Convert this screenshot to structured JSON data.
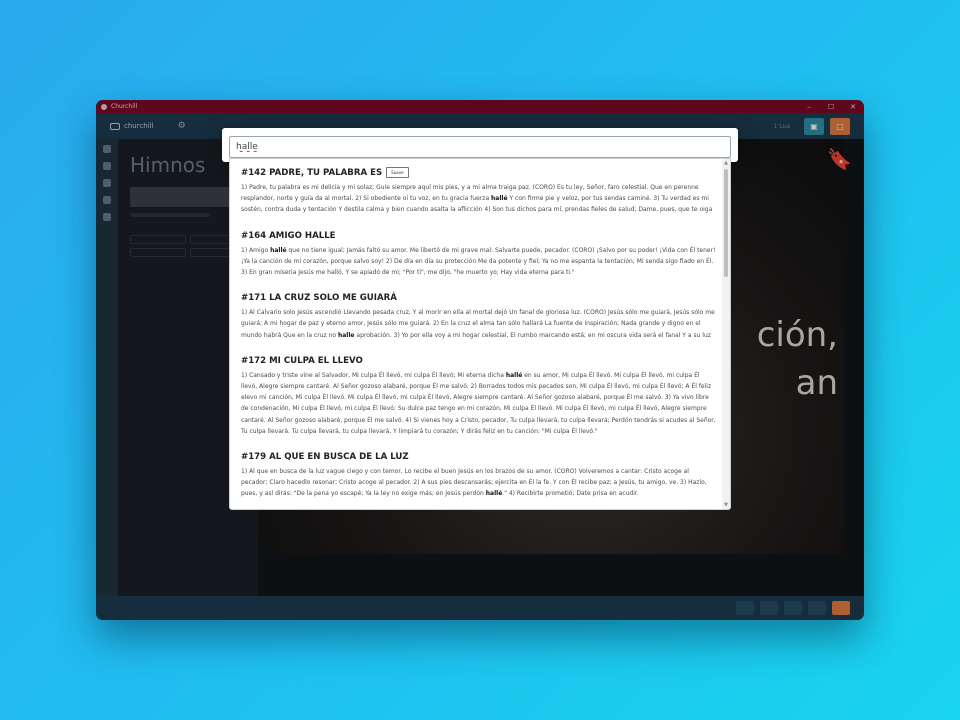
{
  "window": {
    "title": "Churchill",
    "minimize": "–",
    "maximize": "☐",
    "close": "✕"
  },
  "topbar": {
    "app_name": "churchill",
    "language": "1 Lua"
  },
  "left_panel": {
    "heading": "Himnos"
  },
  "preview": {
    "lyric_line_1": "ción,",
    "lyric_line_2": "an"
  },
  "search": {
    "value": "halle"
  },
  "results": [
    {
      "title": "#142 PADRE, TU PALABRA ES",
      "badge": "Suave",
      "text_before": "1) Padre, tu palabra es mi delicia y mi solaz; Guíe siempre aquí mis pies, y a mi alma traiga paz. (CORO) Es tu ley, Señor, faro celestial. Que en perenne resplandor, norte y guía da al mortal. 2) Si obediente oí tu voz, en tu gracia fuerza ",
      "match": "hallé",
      "text_after": " Y con firme pie y veloz, por tus sendas caminé. 3) Tu verdad es mi sostén, contra duda y tentación Y destila calma y bien cuando asalta la aflicción 4) Son tus dichos para mí, prendas fieles de salud; Dame, pues, que te oiga a ti, con filial solicitud"
    },
    {
      "title": "#164 AMIGO HALLE",
      "text_before": "1) Amigo ",
      "match": "hallé",
      "text_after": " que no tiene igual; Jamás faltó su amor. Me libertó de mi grave mal: Salvarte puede, pecador. (CORO) ¡Salvo por su poder! ¡Vida con Él tener! ¡Ya la canción de mi corazón, porque salvo soy! 2) De día en día su protección Me da potente y fiel; Ya no me espanta la tentación; Mi senda sigo fiado en Él. 3) En gran miseria Jesús me halló, Y se apiadó de mi; \"Por ti\", me dijo, \"he muerto yo; Hay vida eterna para ti.\""
    },
    {
      "title": "#171 LA CRUZ SOLO ME GUIARÁ",
      "text_before": "1) Al Calvario solo Jesús ascendió Llevando pesada cruz, Y al morir en ella al mortal dejó Un fanal de gloriosa luz. (CORO) Jesús sólo me guiará, Jesús sólo me guiará; A mi hogar de paz y eterno amor, Jesús sólo me guiará. 2) En la cruz el alma tan sólo hallará La fuente de inspiración; Nada grande y digno en el mundo habrá Que en la cruz no ",
      "match": "halle",
      "text_after": " aprobación. 3) Yo por ella voy a mi hogar celestial, El rumbo marcando está; en mi oscura vida será el fanal Y a su luz mi alma siempre irá."
    },
    {
      "title": "#172 MI CULPA EL LLEVO",
      "text_before": "1) Cansado y triste vine al Salvador, Mi culpa Él llevó, mi culpa Él llevó; Mi eterna dicha ",
      "match": "hallé",
      "text_after": " en su amor, Mi culpa Él llevó. Mi culpa Él llevó, mi culpa Él llevó, Alegre siempre cantaré. Al Señor gozoso alabaré, porque Él me salvó. 2) Borrados todos mis pecados son, Mi culpa Él llevó, mi culpa Él llevó; A Él feliz elevo mi canción, Mi culpa Él llevó. Mi culpa Él llevó, mi culpa Él llevó, Alegre siempre cantaré. Al Señor gozoso alabaré, porque Él me salvó. 3) Ya vivo libre de condenación, Mi culpa Él llevó, mi culpa Él llevó; Su dulce paz tengo en mi corazón, Mi culpa Él llevó. Mi culpa Él llevó, mi culpa Él llevó, Alegre siempre cantaré. Al Señor gozoso alabaré, porque Él me salvó. 4) Si vienes hoy a Cristo, pecador, Tu culpa llevará, tu culpa llevará; Perdón tendrás si acudes al Señor, Tu culpa llevará. Tu culpa llevará, tu culpa llevará, Y limpiará tu corazón; Y dirás feliz en tu canción: \"Mi culpa Él llevó.\""
    },
    {
      "title": "#179 AL QUE EN BUSCA DE LA LUZ",
      "text_before": "1) Al que en busca de la luz vague ciego y con temor, Lo recibe el buen Jesús en los brazos de su amor. (CORO) Volveremos a cantar: Cristo acoge al pecador; Claro hacedlo resonar; Cristo acoge al pecador. 2) A sus pies descansarás; ejercita en Él la fe. Y con Él recibe paz; a Jesús, tu amigo, ve. 3) Hazlo, pues, y así dirás: \"De la pena yo escapé; Ya la ley no exige más; en Jesús perdón ",
      "match": "hallé",
      "text_after": ".\" 4) Recibirte prometió; Date prisa en acudir."
    }
  ]
}
